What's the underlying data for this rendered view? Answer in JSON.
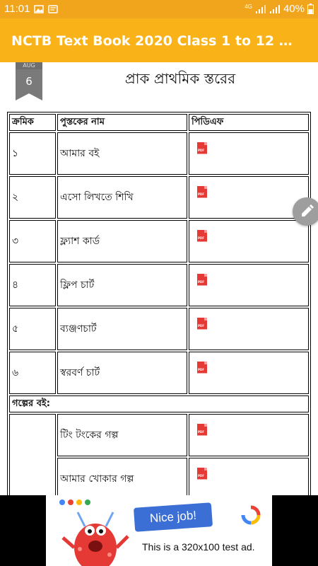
{
  "status_bar": {
    "time": "11:01",
    "network": "4G",
    "battery": "40%"
  },
  "app_bar": {
    "title": "NCTB Text Book 2020 Class 1 to 12 বো..."
  },
  "post": {
    "date_month": "AUG",
    "date_day": "6",
    "heading": "প্রাক প্রাথমিক স্তরের"
  },
  "table": {
    "headers": [
      "ক্রমিক",
      "পুস্তকের নাম",
      "পিডিএফ"
    ],
    "rows": [
      {
        "serial": "১",
        "name": "আমার বই"
      },
      {
        "serial": "২",
        "name": "এসো লিখতে শিখি"
      },
      {
        "serial": "৩",
        "name": "ফ্ল্যাশ কার্ড"
      },
      {
        "serial": "৪",
        "name": "ফ্লিপ চার্ট"
      },
      {
        "serial": "৫",
        "name": "ব্যঞ্জণচার্ট"
      },
      {
        "serial": "৬",
        "name": "স্বরবর্ণ চার্ট"
      }
    ],
    "section_title": "গল্পের বই:",
    "story_rows": [
      {
        "serial": "",
        "name": "টিং টংকের গল্প"
      },
      {
        "serial": "",
        "name": "আমার খোকার গল্প"
      }
    ],
    "pdf_icon_label": "PDF"
  },
  "ad": {
    "bubble_text": "Nice job!",
    "text": "This is a 320x100 test ad."
  },
  "colors": {
    "status_bar": "#F1A51C",
    "app_bar": "#F9B319",
    "pdf_red": "#E53935"
  }
}
